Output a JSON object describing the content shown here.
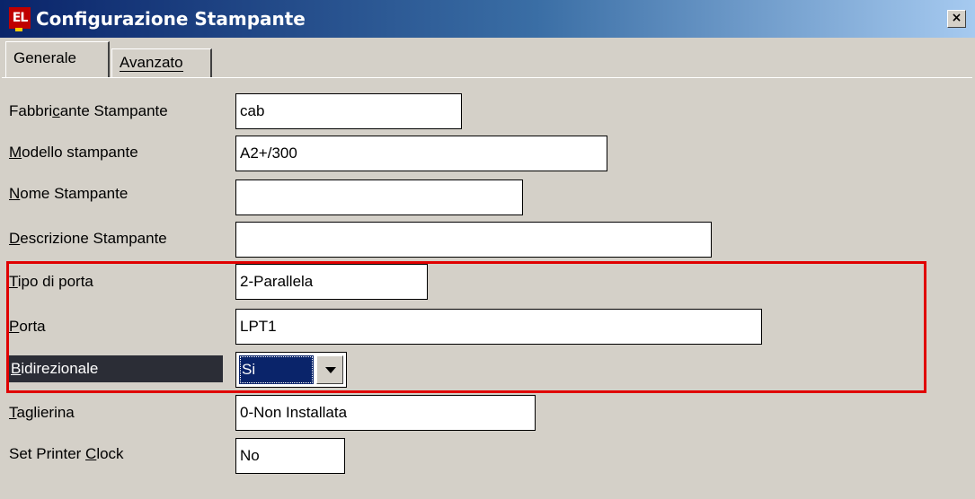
{
  "window": {
    "title": "Configurazione Stampante",
    "icon_text": "EL",
    "close_glyph": "×"
  },
  "tabs": [
    {
      "label": "Generale",
      "active": true
    },
    {
      "label": "Avanzato",
      "active": false
    }
  ],
  "form": {
    "fabbricante": {
      "label_pre": "Fabbri",
      "label_accel": "c",
      "label_post": "ante Stampante",
      "value": "cab"
    },
    "modello": {
      "label_pre": "",
      "label_accel": "M",
      "label_post": "odello stampante",
      "value": "A2+/300"
    },
    "nome": {
      "label_pre": "",
      "label_accel": "N",
      "label_post": "ome Stampante",
      "value": ""
    },
    "descrizione": {
      "label_pre": "",
      "label_accel": "D",
      "label_post": "escrizione Stampante",
      "value": ""
    },
    "tipo_porta": {
      "label_pre": "",
      "label_accel": "T",
      "label_post": "ipo di porta",
      "value": "2-Parallela"
    },
    "porta": {
      "label_pre": "",
      "label_accel": "P",
      "label_post": "orta",
      "value": "LPT1"
    },
    "bidirezionale": {
      "label_pre": "",
      "label_accel": "B",
      "label_post": "idirezionale",
      "value": "Si"
    },
    "taglierina": {
      "label_pre": "",
      "label_accel": "T",
      "label_post": "aglierina",
      "value": "0-Non Installata"
    },
    "clock": {
      "label_pre": "Set Printer ",
      "label_accel": "C",
      "label_post": "lock",
      "value": "No"
    }
  },
  "colors": {
    "highlight": "#e00000",
    "selection": "#0a246a",
    "face": "#d4d0c8"
  }
}
